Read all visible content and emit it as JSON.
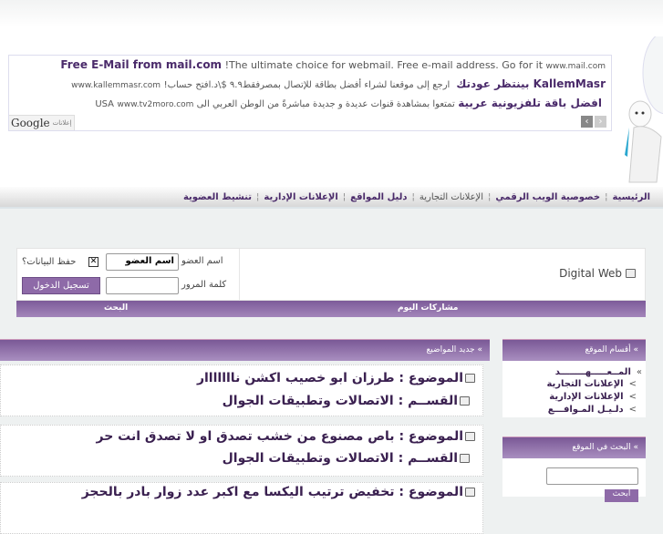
{
  "ads": [
    {
      "title": "Free E-Mail from mail.com",
      "text": "!The ultimate choice for webmail. Free e-mail address. Go for it",
      "url": "www.mail.com"
    },
    {
      "title": "KallemMasr بينتظر عودتك",
      "text": "ارجع إلى موقعنا لشراء أفضل بطاقة للإتصال بمصرفقط٩.٩ $\\د.افتح حساب!",
      "url": "www.kallemmasr.com"
    },
    {
      "title": "افضل باقة تلفزيونية عربية",
      "text": "تمتعوا بمشاهدة قنوات عديدة و جديدة مباشرةً من الوطن العربي الى USA",
      "url": "www.tv2moro.com"
    }
  ],
  "ad_label": "إعلانات",
  "ad_brand": "Google",
  "nav": [
    "الرئيسية",
    "خصوصية الويب الرقمي",
    "الإعلانات التجارية",
    "دليل المواقع",
    "الإعلانات الإدارية",
    "تنشيط العضوية"
  ],
  "brand": "Digital Web",
  "login": {
    "username_label": "اسم العضو",
    "username_value": "اسم العضو",
    "password_label": "كلمة المرور",
    "remember_label": "حفظ البيانات؟",
    "submit": "تسجيل الدخول"
  },
  "bar": {
    "today": "مشاركات اليوم",
    "search": "البحث"
  },
  "latest": {
    "header": "» جديد المواضيع",
    "topics": [
      {
        "subject": "الموضوع : طرزان ابو خصيب اكشن نااااااار",
        "section": "القســم : الاتصالات وتطبيقات الجوال"
      },
      {
        "subject": "الموضوع : باص مصنوع من خشب تصدق او لا تصدق انت حر",
        "section": "القســم : الاتصالات وتطبيقات الجوال"
      },
      {
        "subject": "الموضوع : تخفيض ترتيب اليكسا مع اكبر عدد زوار بادر بالحجز"
      }
    ]
  },
  "sections": {
    "header": "» أقسام الموقع",
    "items": [
      {
        "b": "»",
        "t": "المــعـــــهــــــــد"
      },
      {
        "b": ">",
        "t": "الإعلانات التجارية"
      },
      {
        "b": ">",
        "t": "الإعلانات الإدارية"
      },
      {
        "b": ">",
        "t": "دلـيـل المـوافـــع"
      }
    ]
  },
  "search": {
    "header": "» البحث في الموقع",
    "button": "ابحث"
  }
}
